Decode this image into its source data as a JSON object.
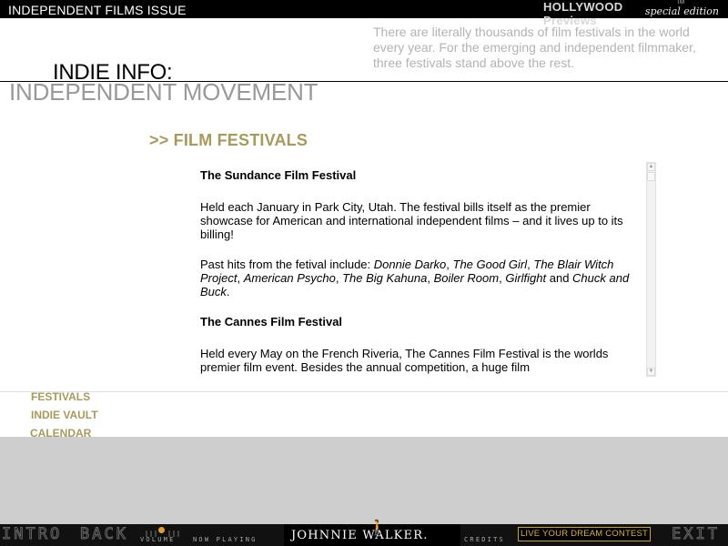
{
  "topbar": {
    "issue_title": "INDEPENDENT FILMS ISSUE",
    "brand_name": "HOLLYWOOD Previews",
    "brand_tm": "TM",
    "brand_edition": "special edition"
  },
  "header": {
    "intro": "There are literally thousands of film festivals in the world every year.  For the emerging and independent filmmaker, three festivals stand above the rest.",
    "title": "INDIE INFO:",
    "subtitle": "INDEPENDENT MOVEMENT"
  },
  "section": {
    "heading": ">> FILM FESTIVALS"
  },
  "content": {
    "sundance_title": "The Sundance Film Festival",
    "sundance_p1": "Held each January in Park City, Utah. The festival bills itself as the premier showcase for American and international independent films – and it lives up to its billing!",
    "sundance_hits_prefix": "Past hits from the fetival include: ",
    "hits": [
      "Donnie Darko",
      "The Good Girl",
      "The Blair Witch Project",
      "American Psycho",
      "The Big Kahuna",
      "Boiler Room",
      "Girlfight",
      "Chuck and Buck"
    ],
    "sep_comma": ", ",
    "sep_comma_wide": ",  ",
    "sep_and": " and ",
    "period": ".",
    "cannes_title": "The Cannes Film Festival",
    "cannes_p1": "Held every May on the French Riveria, The Cannes Film Festival is the worlds premier film event.  Besides the annual competition, a huge film"
  },
  "nav": {
    "festivals": "FESTIVALS",
    "vault": "INDIE VAULT",
    "calendar": "CALENDAR"
  },
  "bottombar": {
    "intro": "INTRO",
    "back": "BACK",
    "volume": "VOLUME",
    "now_playing": "NOW PLAYING",
    "jw_logo": "JOHNNIE WALKER.",
    "credits": "CREDITS",
    "contest": "LIVE YOUR DREAM CONTEST",
    "exit": "EXIT"
  },
  "icons": {
    "scroll_up": "scroll-up-arrow-icon",
    "scroll_down": "scroll-down-arrow-icon",
    "volume_knob": "volume-knob-icon",
    "striding_man": "striding-man-logo-icon"
  },
  "colors": {
    "accent_gold": "#a89a5a",
    "intro_gray": "#b3b3b3",
    "subtitle_gray": "#999999",
    "band_gray": "#cecece",
    "contest_gold": "#e0b030"
  }
}
